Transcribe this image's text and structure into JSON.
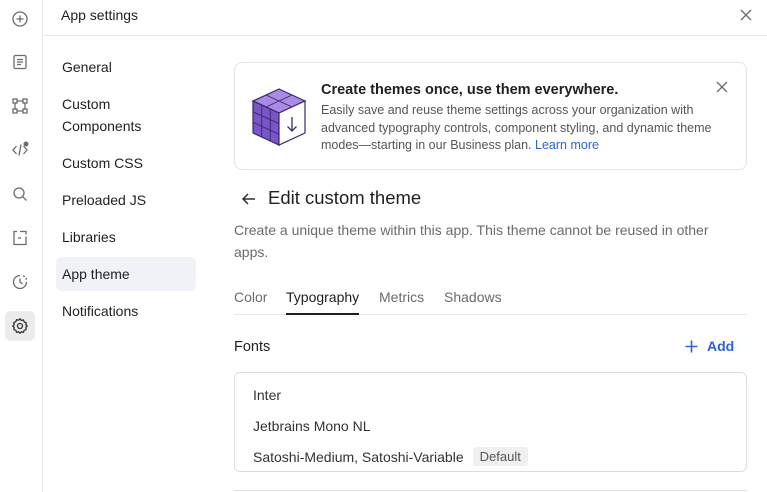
{
  "header": {
    "title": "App settings",
    "close_icon": "close-icon"
  },
  "rail": {
    "icons": [
      "plus-circle-icon",
      "document-icon",
      "workflow-icon",
      "code-icon",
      "search-icon",
      "state-icon",
      "history-icon",
      "gear-icon"
    ],
    "active": "gear-icon"
  },
  "nav": {
    "items": [
      {
        "label": "General"
      },
      {
        "label": "Custom Components"
      },
      {
        "label": "Custom CSS"
      },
      {
        "label": "Preloaded JS"
      },
      {
        "label": "Libraries"
      },
      {
        "label": "App theme"
      },
      {
        "label": "Notifications"
      }
    ],
    "selected": "App theme"
  },
  "banner": {
    "title": "Create themes once, use them everywhere.",
    "body": "Easily save and reuse theme settings across your organization with advanced typography controls, component styling, and dynamic theme modes—starting in our Business plan.",
    "link": "Learn more"
  },
  "page": {
    "title": "Edit custom theme",
    "description": "Create a unique theme within this app. This theme cannot be reused in other apps."
  },
  "tabs": [
    {
      "label": "Color"
    },
    {
      "label": "Typography"
    },
    {
      "label": "Metrics"
    },
    {
      "label": "Shadows"
    }
  ],
  "active_tab": "Typography",
  "fonts": {
    "label": "Fonts",
    "add_label": "Add",
    "items": [
      {
        "name": "Inter",
        "badge": ""
      },
      {
        "name": "Jetbrains Mono NL",
        "badge": ""
      },
      {
        "name": "Satoshi-Medium, Satoshi-Variable",
        "badge": "Default"
      }
    ]
  },
  "colors": {
    "accent": "#2a63d8",
    "banner_cube": "#7a55c9"
  }
}
